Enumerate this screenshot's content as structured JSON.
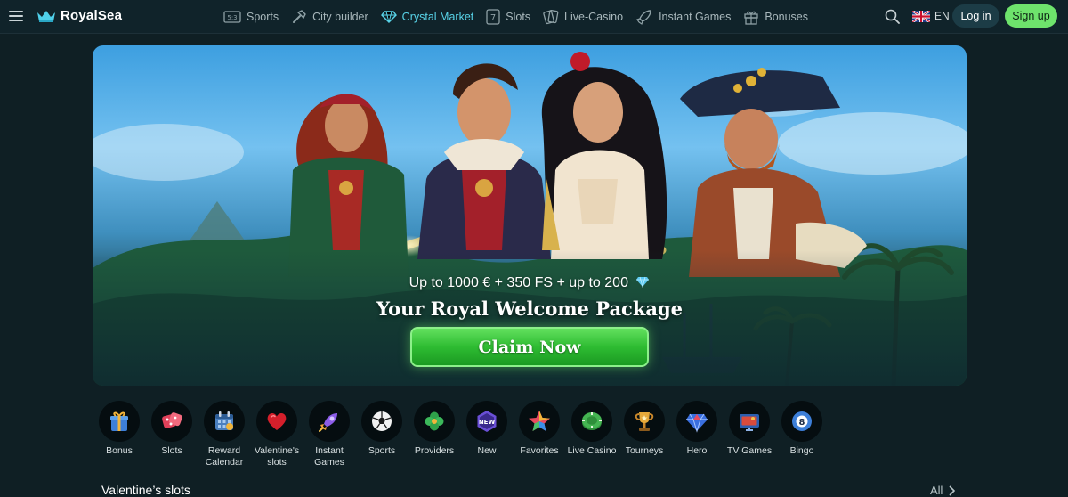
{
  "brand": {
    "name": "RoyalSea"
  },
  "nav": {
    "items": [
      {
        "label": "Sports",
        "icon": "scoreboard-icon",
        "active": false
      },
      {
        "label": "City builder",
        "icon": "hammer-icon",
        "active": false
      },
      {
        "label": "Crystal Market",
        "icon": "diamond-icon",
        "active": true
      },
      {
        "label": "Slots",
        "icon": "seven-slot-icon",
        "active": false
      },
      {
        "label": "Live-Casino",
        "icon": "cards-icon",
        "active": false
      },
      {
        "label": "Instant Games",
        "icon": "rocket-icon",
        "active": false
      },
      {
        "label": "Bonuses",
        "icon": "gift-icon",
        "active": false
      }
    ]
  },
  "header": {
    "language": "EN",
    "login_label": "Log in",
    "signup_label": "Sign up"
  },
  "banner": {
    "offer": "Up to 1000 € + 350 FS + up to 200",
    "title": "Your Royal Welcome Package",
    "cta_label": "Claim Now"
  },
  "categories": [
    {
      "label": "Bonus",
      "icon": "gift-box-icon"
    },
    {
      "label": "Slots",
      "icon": "dice-icon"
    },
    {
      "label": "Reward Calendar",
      "icon": "calendar-icon"
    },
    {
      "label": "Valentine's slots",
      "icon": "heart-icon"
    },
    {
      "label": "Instant Games",
      "icon": "rocket-icon"
    },
    {
      "label": "Sports",
      "icon": "soccer-ball-icon"
    },
    {
      "label": "Providers",
      "icon": "clover-icon"
    },
    {
      "label": "New",
      "icon": "new-badge-icon"
    },
    {
      "label": "Favorites",
      "icon": "star-icon"
    },
    {
      "label": "Live Casino",
      "icon": "chip-icon"
    },
    {
      "label": "Tourneys",
      "icon": "trophy-icon"
    },
    {
      "label": "Hero",
      "icon": "hero-gem-icon"
    },
    {
      "label": "TV Games",
      "icon": "tv-icon"
    },
    {
      "label": "Bingo",
      "icon": "bingo-ball-icon"
    }
  ],
  "section": {
    "title": "Valentine’s slots",
    "all_label": "All"
  },
  "colors": {
    "background": "#0f1f24",
    "header": "#10232a",
    "accent_active": "#58d3e8",
    "signup": "#6ee36c",
    "cta": "#2ebc32"
  }
}
